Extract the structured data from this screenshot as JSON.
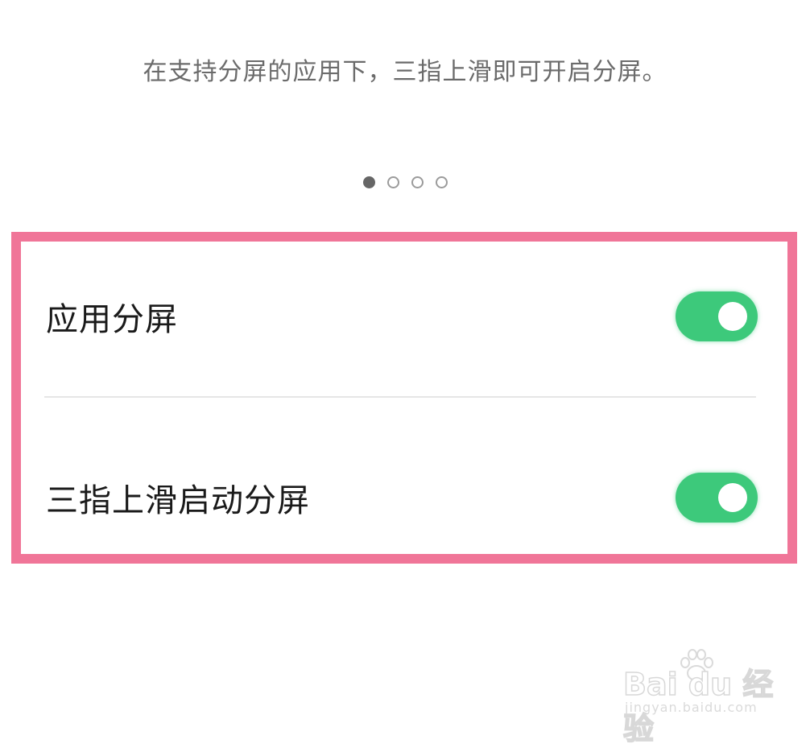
{
  "hint_text": "在支持分屏的应用下，三指上滑即可开启分屏。",
  "page_indicator": {
    "total": 4,
    "active": 1
  },
  "settings": [
    {
      "label": "应用分屏",
      "enabled": true
    },
    {
      "label": "三指上滑启动分屏",
      "enabled": true
    }
  ],
  "colors": {
    "toggle_on": "#3dc97b",
    "highlight_border": "#f07598",
    "hint_text": "#6b6b6b"
  },
  "watermark": {
    "logo": "Bai du 经验",
    "domain": "jingyan.baidu.com"
  }
}
